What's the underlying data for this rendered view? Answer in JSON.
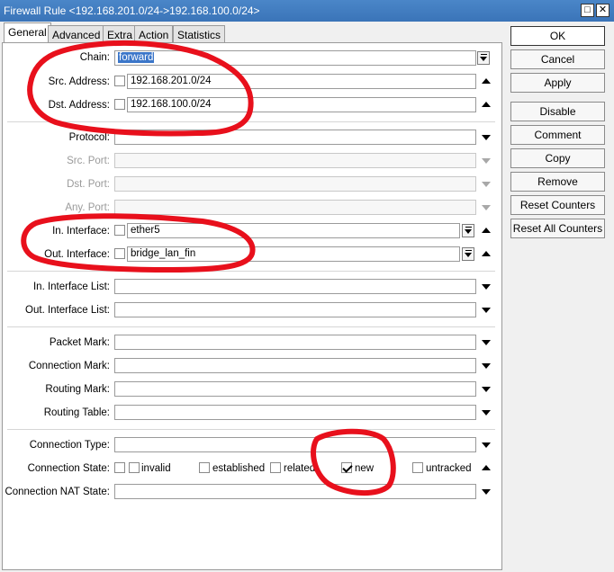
{
  "window": {
    "title": "Firewall Rule <192.168.201.0/24->192.168.100.0/24>"
  },
  "tabs": [
    "General",
    "Advanced",
    "Extra",
    "Action",
    "Statistics"
  ],
  "fields": {
    "chain": {
      "label": "Chain:",
      "value": "forward"
    },
    "src_address": {
      "label": "Src. Address:",
      "value": "192.168.201.0/24"
    },
    "dst_address": {
      "label": "Dst. Address:",
      "value": "192.168.100.0/24"
    },
    "protocol": {
      "label": "Protocol:",
      "value": ""
    },
    "src_port": {
      "label": "Src. Port:",
      "value": ""
    },
    "dst_port": {
      "label": "Dst. Port:",
      "value": ""
    },
    "any_port": {
      "label": "Any. Port:",
      "value": ""
    },
    "in_interface": {
      "label": "In. Interface:",
      "value": "ether5"
    },
    "out_interface": {
      "label": "Out. Interface:",
      "value": "bridge_lan_fin"
    },
    "in_interface_list": {
      "label": "In. Interface List:",
      "value": ""
    },
    "out_interface_list": {
      "label": "Out. Interface List:",
      "value": ""
    },
    "packet_mark": {
      "label": "Packet Mark:",
      "value": ""
    },
    "connection_mark": {
      "label": "Connection Mark:",
      "value": ""
    },
    "routing_mark": {
      "label": "Routing Mark:",
      "value": ""
    },
    "routing_table": {
      "label": "Routing Table:",
      "value": ""
    },
    "connection_type": {
      "label": "Connection Type:",
      "value": ""
    },
    "connection_state": {
      "label": "Connection State:",
      "options": [
        {
          "label": "invalid",
          "checked": false
        },
        {
          "label": "established",
          "checked": false
        },
        {
          "label": "related",
          "checked": false
        },
        {
          "label": "new",
          "checked": true
        },
        {
          "label": "untracked",
          "checked": false
        }
      ]
    },
    "connection_nat_state": {
      "label": "Connection NAT State:",
      "value": ""
    }
  },
  "buttons": [
    "OK",
    "Cancel",
    "Apply",
    "Disable",
    "Comment",
    "Copy",
    "Remove",
    "Reset Counters",
    "Reset All Counters"
  ],
  "annotation_color": "#e8101c"
}
